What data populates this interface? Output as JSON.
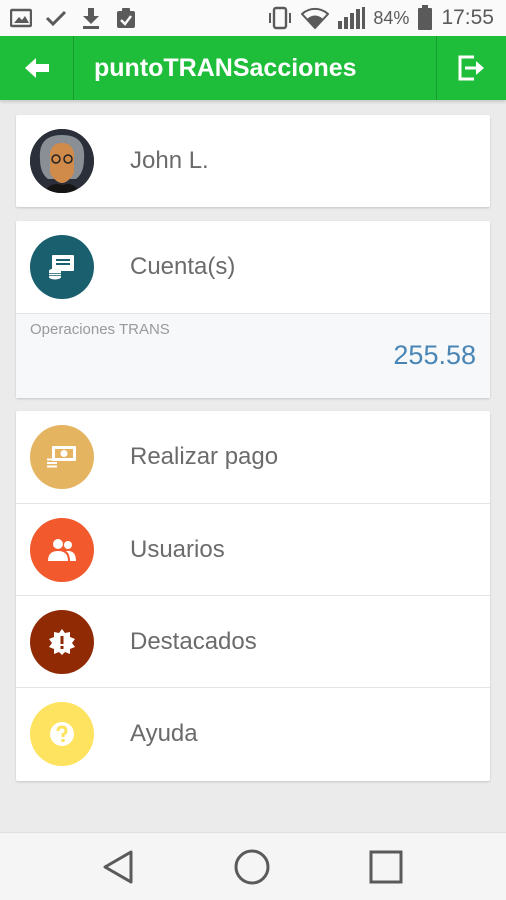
{
  "status_bar": {
    "battery_percent": "84%",
    "time": "17:55",
    "left_icons": [
      "image-icon",
      "check-icon",
      "download-icon",
      "clipboard-icon"
    ],
    "right_icons": [
      "vibrate-icon",
      "wifi-icon",
      "signal-icon",
      "battery-icon"
    ]
  },
  "app_bar": {
    "title": "puntoTRANSacciones",
    "back_icon": "arrow-left-icon",
    "exit_icon": "exit-icon",
    "color": "#1fbe3a"
  },
  "profile": {
    "name": "John L.",
    "avatar": "user-avatar"
  },
  "accounts": {
    "label": "Cuenta(s)",
    "icon": "accounts-icon",
    "icon_color": "#1a5f6e",
    "operations_label": "Operaciones TRANS",
    "operations_value": "255.58"
  },
  "menu": {
    "items": [
      {
        "label": "Realizar pago",
        "icon": "payment-icon",
        "color": "#e5b460"
      },
      {
        "label": "Usuarios",
        "icon": "users-icon",
        "color": "#f25a2d"
      },
      {
        "label": "Destacados",
        "icon": "featured-icon",
        "color": "#8f2a05"
      },
      {
        "label": "Ayuda",
        "icon": "help-icon",
        "color": "#fde35f"
      }
    ]
  },
  "nav_bar": {
    "buttons": [
      "back-triangle-icon",
      "home-circle-icon",
      "recents-square-icon"
    ]
  }
}
